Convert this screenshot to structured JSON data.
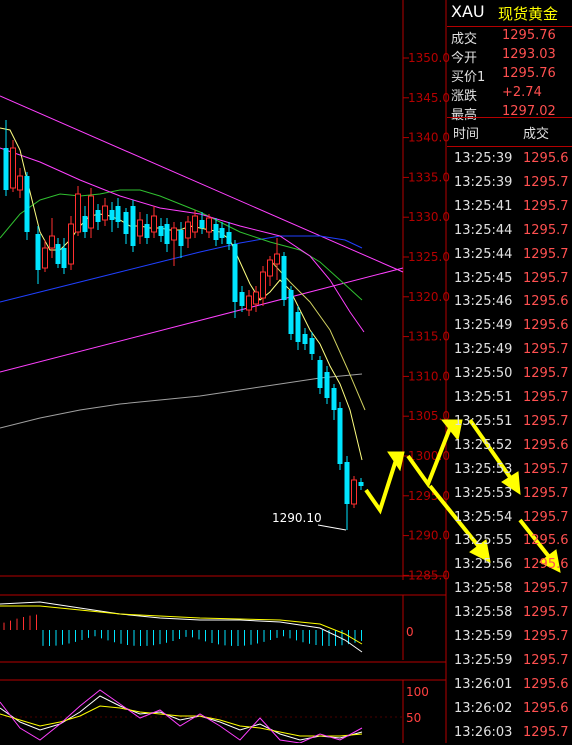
{
  "chart": {
    "price_axis": [
      "1350.0",
      "1345.0",
      "1340.0",
      "1335.0",
      "1330.0",
      "1325.0",
      "1320.0",
      "1315.0",
      "1310.0",
      "1305.0",
      "1300.0",
      "1295.0",
      "1290.0",
      "1285.0"
    ],
    "low_label": "1290.10",
    "macd_zero": "0",
    "kdj_axis": [
      "100",
      "50"
    ],
    "colors": {
      "up": "#ff3030",
      "down": "#00e5ff",
      "ma_yellow": "#ffff80",
      "ma_green": "#30c030",
      "ma_blue": "#2040ff",
      "ma_magenta": "#ff40ff",
      "ma_grey": "#a0a0a0",
      "arrow": "#ffff00",
      "axis": "#b40000"
    }
  },
  "panel": {
    "symbol": "XAU",
    "name": "现货黄金",
    "quote": [
      {
        "label": "成交",
        "value": "1295.76"
      },
      {
        "label": "今开",
        "value": "1293.03"
      },
      {
        "label": "买价1",
        "value": "1295.76"
      },
      {
        "label": "涨跌",
        "value": "+2.74"
      },
      {
        "label": "最高",
        "value": "1297.02"
      }
    ],
    "tick_header": {
      "time": "时间",
      "price": "成交"
    },
    "ticks": [
      {
        "time": "13:25:39",
        "price": "1295.6"
      },
      {
        "time": "13:25:39",
        "price": "1295.7"
      },
      {
        "time": "13:25:41",
        "price": "1295.7"
      },
      {
        "time": "13:25:44",
        "price": "1295.7"
      },
      {
        "time": "13:25:44",
        "price": "1295.7"
      },
      {
        "time": "13:25:45",
        "price": "1295.7"
      },
      {
        "time": "13:25:46",
        "price": "1295.6"
      },
      {
        "time": "13:25:49",
        "price": "1295.6"
      },
      {
        "time": "13:25:49",
        "price": "1295.7"
      },
      {
        "time": "13:25:50",
        "price": "1295.7"
      },
      {
        "time": "13:25:51",
        "price": "1295.7"
      },
      {
        "time": "13:25:51",
        "price": "1295.7"
      },
      {
        "time": "13:25:52",
        "price": "1295.6"
      },
      {
        "time": "13:25:53",
        "price": "1295.7"
      },
      {
        "time": "13:25:53",
        "price": "1295.7"
      },
      {
        "time": "13:25:54",
        "price": "1295.7"
      },
      {
        "time": "13:25:55",
        "price": "1295.6"
      },
      {
        "time": "13:25:56",
        "price": "1295.6"
      },
      {
        "time": "13:25:58",
        "price": "1295.7"
      },
      {
        "time": "13:25:58",
        "price": "1295.7"
      },
      {
        "time": "13:25:59",
        "price": "1295.7"
      },
      {
        "time": "13:25:59",
        "price": "1295.7"
      },
      {
        "time": "13:26:01",
        "price": "1295.6"
      },
      {
        "time": "13:26:02",
        "price": "1295.6"
      },
      {
        "time": "13:26:03",
        "price": "1295.7"
      }
    ]
  }
}
